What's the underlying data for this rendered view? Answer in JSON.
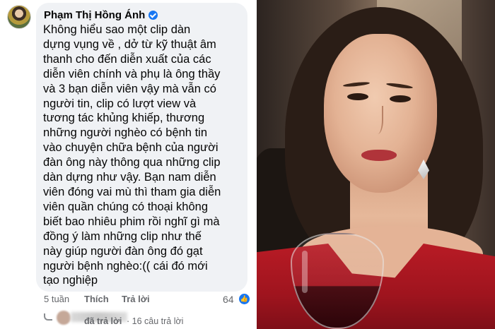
{
  "comment": {
    "author": "Phạm Thị Hồng Ánh",
    "lines": [
      "Không hiểu sao một clip  dàn",
      "dựng vụng về , dở từ kỹ thuật âm",
      "thanh cho đến diễn xuất của các",
      "diễn viên chính và phụ là ông thầy",
      "và 3 bạn diễn viên vậy mà vẫn có",
      "người tin, clip có lượt view và",
      "tương tác khủng khiếp, thương",
      "những người nghèo  có bệnh tin",
      "vào chuyện chữa bệnh của người",
      "đàn ông này thông qua những clip",
      "dàn dựng như vậy. Bạn nam diễn",
      "viên đóng vai mù thì tham gia diễn",
      "viên quần chúng có thoại không",
      "biết bao nhiêu phim rồi nghĩ gì mà",
      "đồng ý làm những clip như thế",
      "này giúp người đàn ông đó gạt",
      "người bệnh nghèo:(( cái đó mới",
      "tạo nghiệp"
    ]
  },
  "actions": {
    "time": "5 tuần",
    "like": "Thích",
    "reply": "Trả lời",
    "reaction_count": "64",
    "reaction_icon": "like-icon"
  },
  "replies": {
    "replied_label": "đã trả lời",
    "count_label": "· 16 câu trả lời"
  },
  "colors": {
    "bubble": "#f0f2f5",
    "meta_text": "#65676b",
    "accent": "#1877f2"
  }
}
